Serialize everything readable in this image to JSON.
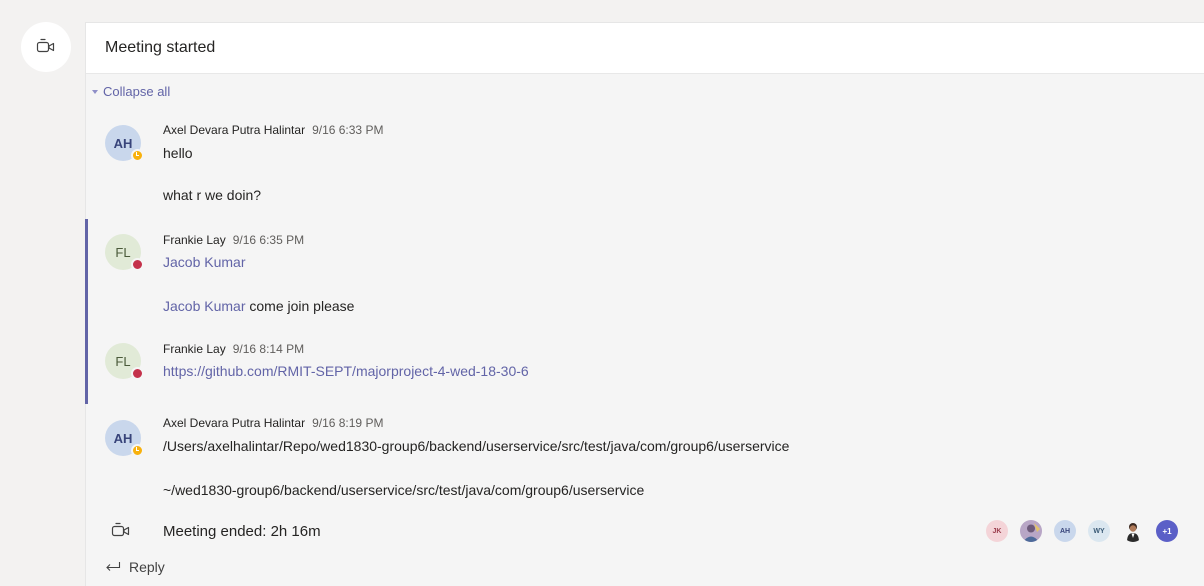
{
  "card": {
    "title": "Meeting started",
    "collapse_label": "Collapse all"
  },
  "messages": [
    {
      "initials": "AH",
      "author": "Axel Devara Putra Halintar",
      "time": "9/16 6:33 PM",
      "status": "away",
      "line1": "hello",
      "line2": "what r we doin?"
    },
    {
      "initials": "FL",
      "author": "Frankie Lay",
      "time": "9/16 6:35 PM",
      "status": "busy",
      "mention1": "Jacob Kumar",
      "mention2": "Jacob Kumar",
      "line2_rest": " come join please"
    },
    {
      "initials": "FL",
      "author": "Frankie Lay",
      "time": "9/16 8:14 PM",
      "status": "busy",
      "link": "https://github.com/RMIT-SEPT/majorproject-4-wed-18-30-6"
    },
    {
      "initials": "AH",
      "author": "Axel Devara Putra Halintar",
      "time": "9/16 8:19 PM",
      "status": "away",
      "line1": "/Users/axelhalintar/Repo/wed1830-group6/backend/userservice/src/test/java/com/group6/userservice",
      "line2": "~/wed1830-group6/backend/userservice/src/test/java/com/group6/userservice"
    }
  ],
  "meeting_ended": {
    "text": "Meeting ended: 2h 16m",
    "participants": [
      {
        "initials": "JK",
        "kind": "initials"
      },
      {
        "initials": "",
        "kind": "photo"
      },
      {
        "initials": "AH",
        "kind": "initials"
      },
      {
        "initials": "WY",
        "kind": "initials"
      },
      {
        "initials": "",
        "kind": "photo"
      },
      {
        "initials": "+1",
        "kind": "more"
      }
    ]
  },
  "reply_label": "Reply",
  "colors": {
    "accent": "#6264a7",
    "away": "#f8b10d",
    "busy": "#c4314b"
  }
}
